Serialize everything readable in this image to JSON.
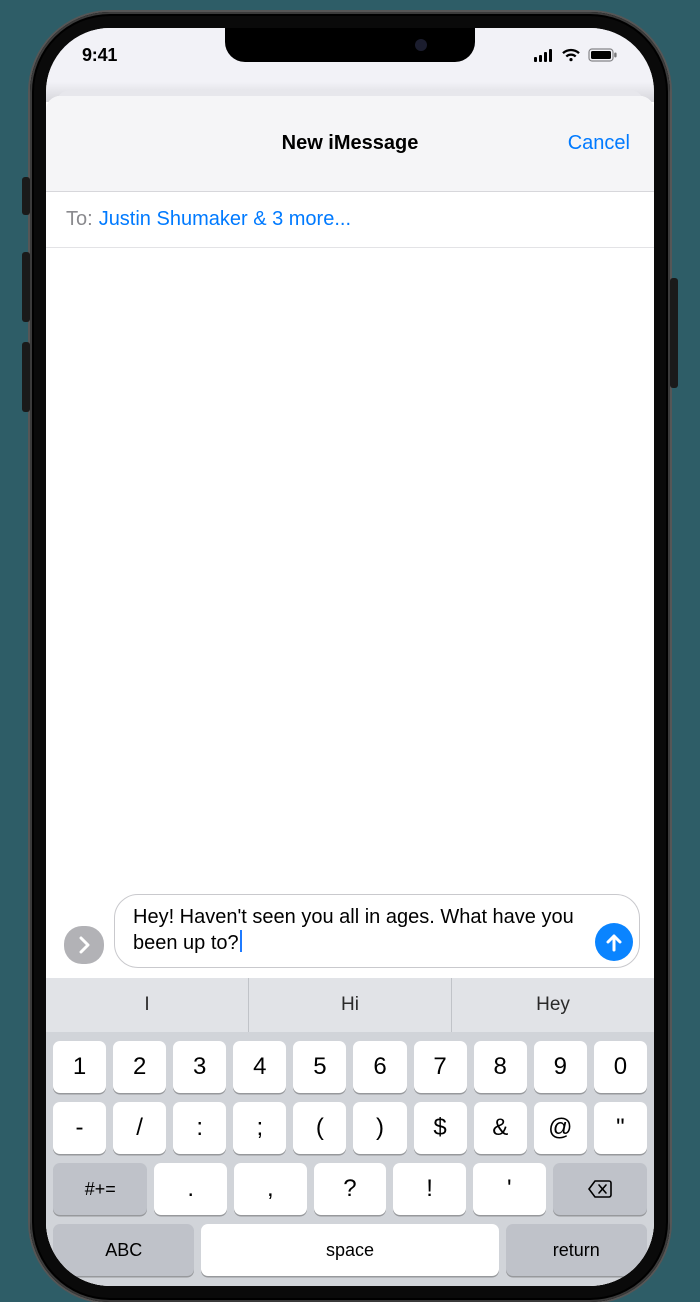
{
  "status": {
    "time": "9:41"
  },
  "nav": {
    "title": "New iMessage",
    "cancel": "Cancel"
  },
  "to": {
    "label": "To:",
    "value": "Justin Shumaker & 3 more..."
  },
  "compose": {
    "text": "Hey! Haven't seen you all in ages. What have you been up to?"
  },
  "suggestions": [
    "I",
    "Hi",
    "Hey"
  ],
  "keyboard": {
    "row1": [
      "1",
      "2",
      "3",
      "4",
      "5",
      "6",
      "7",
      "8",
      "9",
      "0"
    ],
    "row2": [
      "-",
      "/",
      ":",
      ";",
      "(",
      ")",
      "$",
      "&",
      "@",
      "\""
    ],
    "sym": "#+=",
    "row3": [
      ".",
      ",",
      "?",
      "!",
      "'"
    ],
    "abc": "ABC",
    "space": "space",
    "ret": "return"
  }
}
